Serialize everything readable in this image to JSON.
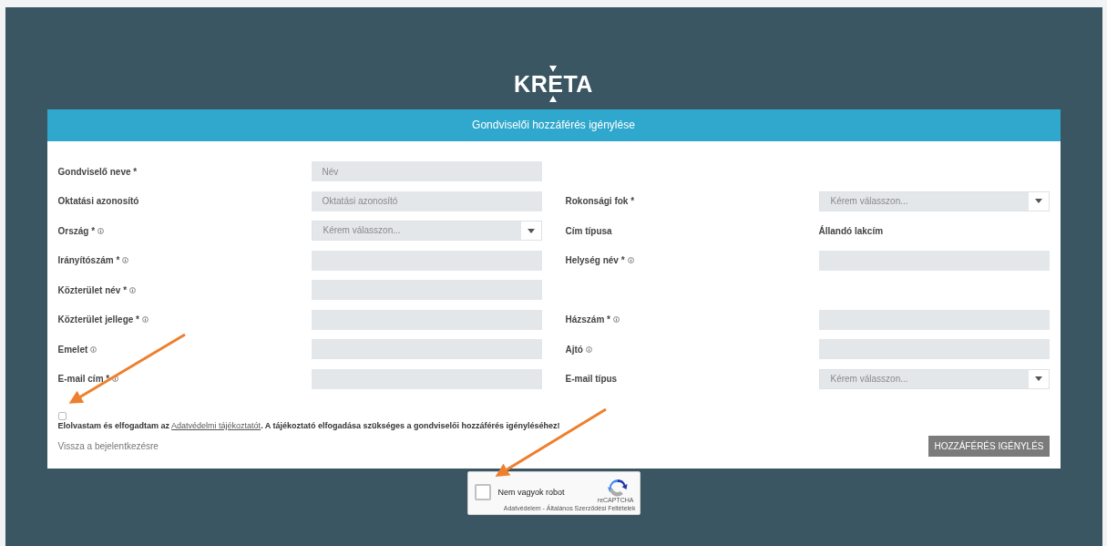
{
  "logo": {
    "text": "KRETA"
  },
  "form": {
    "title": "Gondviselői hozzáférés igénylése",
    "rows": [
      {
        "left": {
          "label": "Gondviselő neve *",
          "info": false,
          "field": {
            "kind": "input",
            "placeholder": "Név"
          }
        },
        "right": null
      },
      {
        "left": {
          "label": "Oktatási azonosító",
          "info": false,
          "field": {
            "kind": "input",
            "placeholder": "Oktatási azonosító"
          }
        },
        "right": {
          "label": "Rokonsági fok *",
          "info": false,
          "field": {
            "kind": "select",
            "placeholder": "Kérem válasszon..."
          }
        }
      },
      {
        "left": {
          "label": "Ország *",
          "info": true,
          "field": {
            "kind": "select",
            "placeholder": "Kérem válasszon..."
          }
        },
        "right": {
          "label": "Cím típusa",
          "info": false,
          "field": {
            "kind": "text",
            "value": "Állandó lakcím"
          }
        }
      },
      {
        "left": {
          "label": "Irányítószám *",
          "info": true,
          "field": {
            "kind": "input"
          }
        },
        "right": {
          "label": "Helység név *",
          "info": true,
          "field": {
            "kind": "input"
          }
        }
      },
      {
        "left": {
          "label": "Közterület név *",
          "info": true,
          "field": {
            "kind": "input"
          }
        },
        "right": null
      },
      {
        "left": {
          "label": "Közterület jellege *",
          "info": true,
          "field": {
            "kind": "input"
          }
        },
        "right": {
          "label": "Házszám *",
          "info": true,
          "field": {
            "kind": "input"
          }
        }
      },
      {
        "left": {
          "label": "Emelet",
          "info": true,
          "field": {
            "kind": "input"
          }
        },
        "right": {
          "label": "Ajtó",
          "info": true,
          "field": {
            "kind": "input"
          }
        }
      },
      {
        "left": {
          "label": "E-mail cím *",
          "info": true,
          "field": {
            "kind": "input"
          }
        },
        "right": {
          "label": "E-mail típus",
          "info": false,
          "field": {
            "kind": "select",
            "placeholder": "Kérem válasszon..."
          }
        }
      }
    ],
    "consent": {
      "checked": false,
      "text": "**Elolvastam és elfogadtam az** ",
      "link": "Adatvédelmi tájékoztatót",
      "after": ". A tájékoztató elfogadása szükséges a gondviselői hozzáférés igényléséhez!"
    },
    "back_link": "Vissza a bejelentkezésre",
    "submit": "HOZZÁFÉRÉS IGÉNYLÉS"
  },
  "captcha": {
    "checked": false,
    "label": "Nem vagyok robot",
    "brand": "reCAPTCHA",
    "links": "Adatvédelem - Általános Szerződési Feltételek"
  }
}
